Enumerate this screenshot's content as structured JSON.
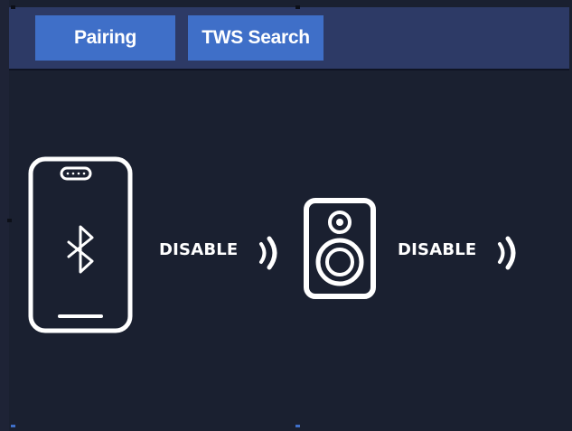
{
  "tabs": [
    {
      "label": "Pairing"
    },
    {
      "label": "TWS Search"
    }
  ],
  "devices": {
    "phone": {
      "icon": "phone-bluetooth-icon",
      "status": "DISABLE"
    },
    "speaker": {
      "icon": "speaker-icon",
      "status": "DISABLE"
    }
  },
  "signal_icon": "signal-waves-icon",
  "colors": {
    "background": "#1a2030",
    "topbar": "#2d3a66",
    "tab": "#3f6fc8",
    "text": "#ffffff"
  }
}
